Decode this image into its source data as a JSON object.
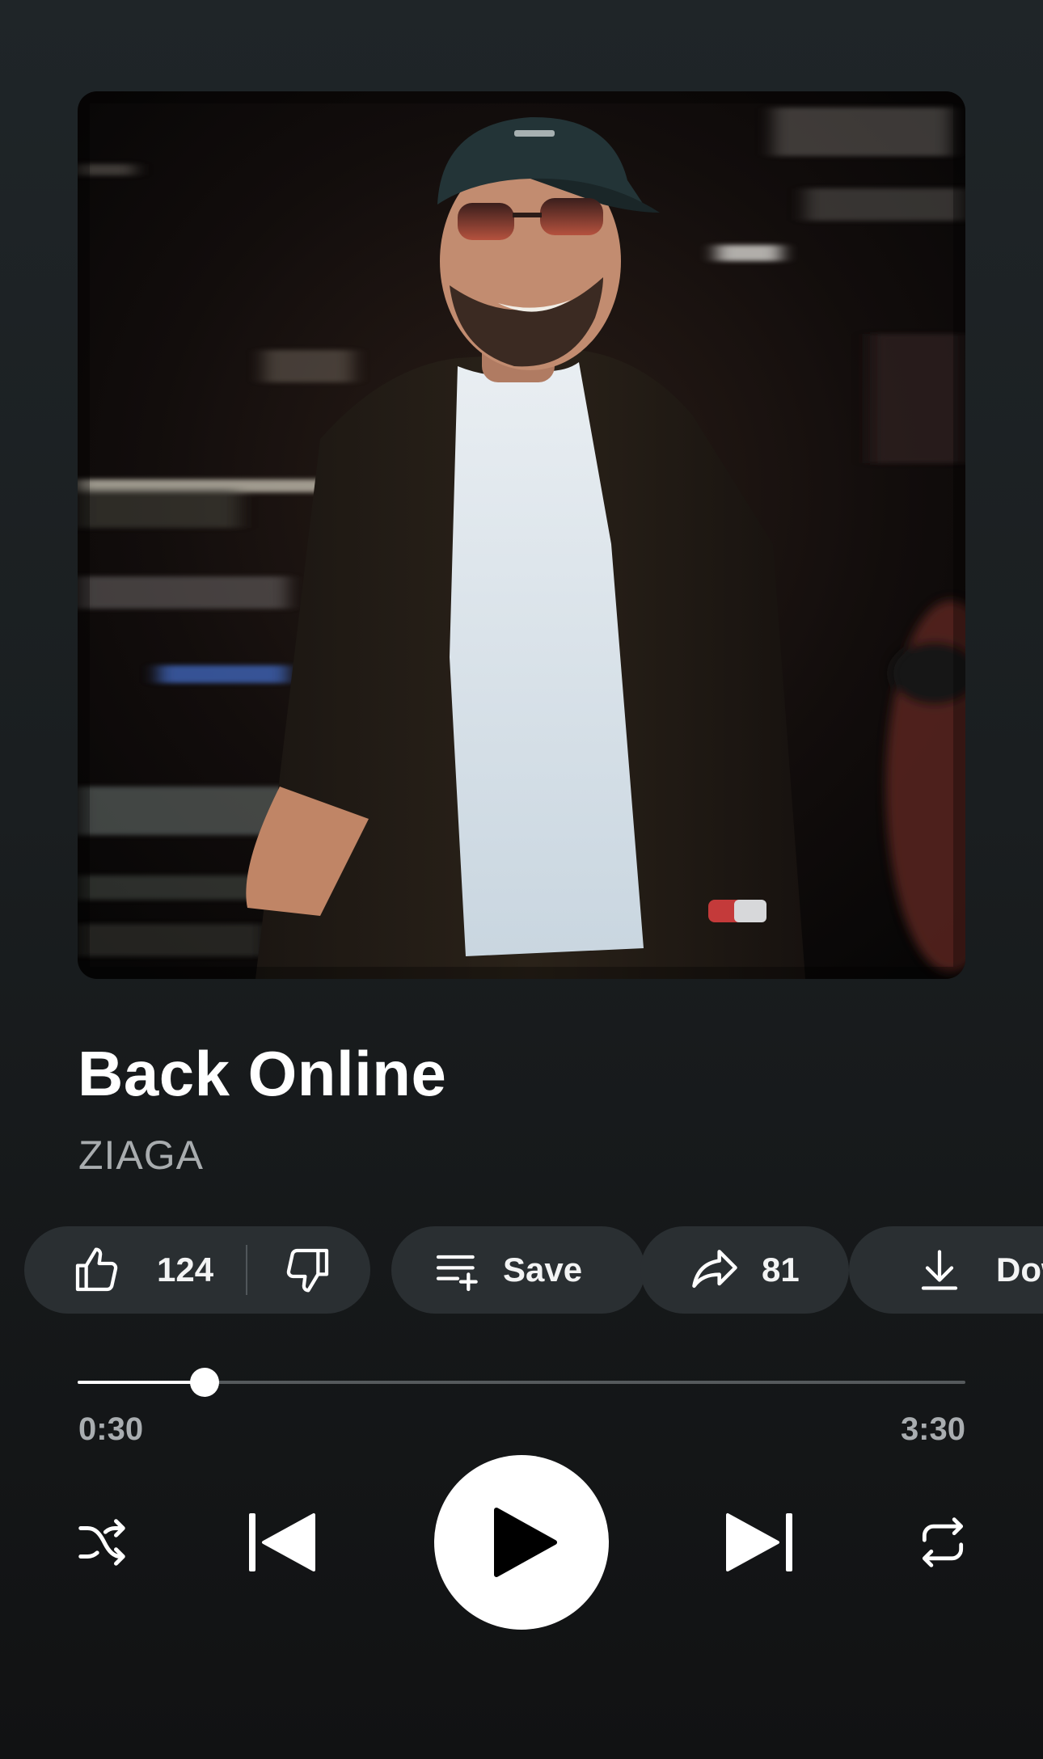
{
  "track": {
    "title": "Back Online",
    "artist": "ZIAGA"
  },
  "actions": {
    "like_count": "124",
    "save_label": "Save",
    "share_count": "81",
    "download_label": "Dow"
  },
  "playback": {
    "elapsed": "0:30",
    "total": "3:30",
    "progress_fraction": 0.143,
    "state": "paused"
  },
  "icons": {
    "like": "thumbs-up-icon",
    "dislike": "thumbs-down-icon",
    "save": "playlist-add-icon",
    "share": "share-arrow-icon",
    "download": "download-icon",
    "shuffle": "shuffle-icon",
    "previous": "skip-previous-icon",
    "play": "play-icon",
    "next": "skip-next-icon",
    "repeat": "repeat-icon"
  },
  "colors": {
    "background": "#1a1e20",
    "chip": "#2a2f32",
    "secondary_text": "#a8acae",
    "progress_track": "#55595c",
    "progress_fill": "#ffffff"
  }
}
